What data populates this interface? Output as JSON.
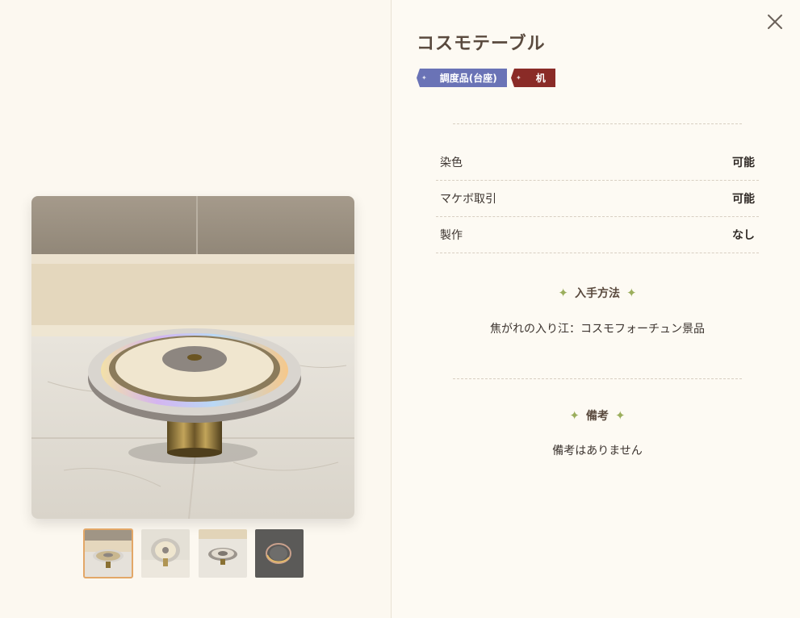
{
  "item": {
    "title": "コスモテーブル",
    "tags": [
      {
        "label": "調度品(台座)",
        "color": "#6a73b6"
      },
      {
        "label": "机",
        "color": "#8a2b27"
      }
    ]
  },
  "properties": [
    {
      "label": "染色",
      "value": "可能"
    },
    {
      "label": "マケボ取引",
      "value": "可能"
    },
    {
      "label": "製作",
      "value": "なし"
    }
  ],
  "acquisition": {
    "heading": "入手方法",
    "text": "焦がれの入り江：コスモフォーチュン景品"
  },
  "notes": {
    "heading": "備考",
    "text": "備考はありません"
  },
  "icons": {
    "close": "close-icon",
    "sparkle": "sparkle-icon"
  },
  "gallery": {
    "thumbnail_count": 4,
    "active_index": 0
  }
}
